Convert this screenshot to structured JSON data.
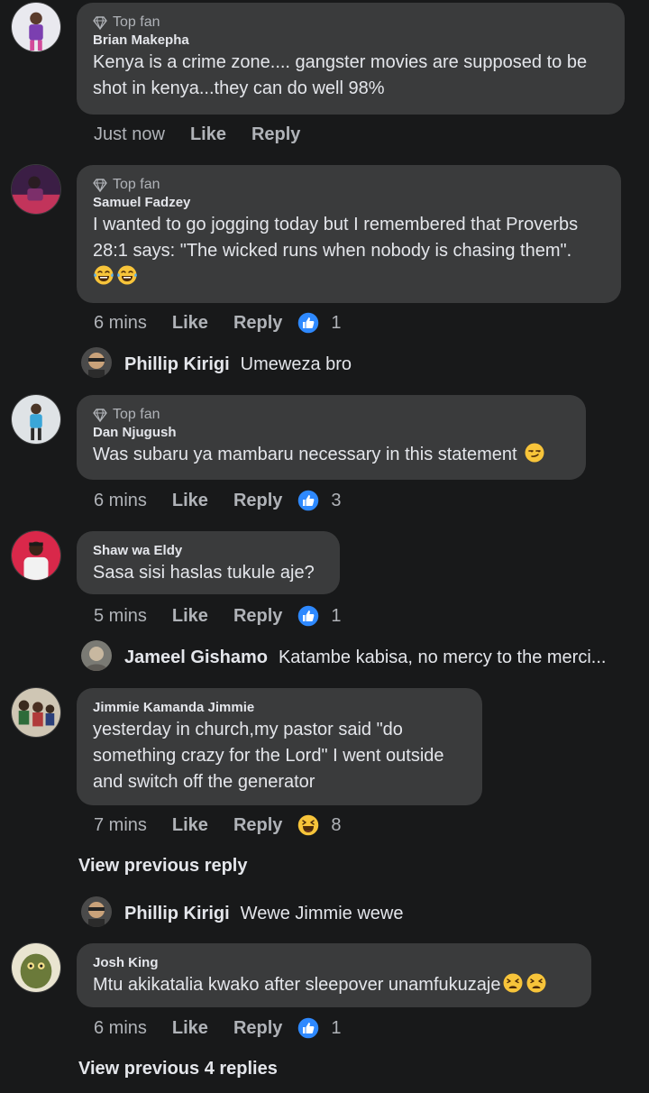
{
  "comments": [
    {
      "badge": "Top fan",
      "author": "Brian Makepha",
      "text": "Kenya is a crime zone.... gangster movies are supposed to be shot in kenya...they can do well 98%",
      "time": "Just now",
      "like": "Like",
      "reply": "Reply"
    },
    {
      "badge": "Top fan",
      "author": "Samuel Fadzey",
      "text": "I wanted to go jogging today but I remembered that Proverbs 28:1 says: \"The wicked runs when nobody is chasing them\".",
      "emojis": [
        "laughing-tears-emoji",
        "laughing-tears-emoji"
      ],
      "time": "6 mins",
      "like": "Like",
      "reply": "Reply",
      "reaction": "like-icon",
      "reaction_count": "1",
      "mini_reply": {
        "name": "Phillip Kirigi",
        "text": "Umeweza bro"
      }
    },
    {
      "badge": "Top fan",
      "author": "Dan Njugush",
      "text": "Was subaru ya mambaru necessary in this statement",
      "emojis": [
        "smirk-emoji"
      ],
      "time": "6 mins",
      "like": "Like",
      "reply": "Reply",
      "reaction": "like-icon",
      "reaction_count": "3"
    },
    {
      "author": "Shaw wa Eldy",
      "text": "Sasa sisi haslas tukule aje?",
      "time": "5 mins",
      "like": "Like",
      "reply": "Reply",
      "reaction": "like-icon",
      "reaction_count": "1",
      "mini_reply": {
        "name": "Jameel Gishamo",
        "text": "Katambe kabisa, no mercy to the merci..."
      }
    },
    {
      "author": "Jimmie Kamanda Jimmie",
      "text": "yesterday in church,my pastor said \"do something crazy for the Lord\" I went outside and switch off the generator",
      "time": "7 mins",
      "like": "Like",
      "reply": "Reply",
      "reaction": "haha-icon",
      "reaction_count": "8",
      "view_previous": "View previous reply",
      "mini_reply": {
        "name": "Phillip Kirigi",
        "text": "Wewe Jimmie wewe"
      }
    },
    {
      "author": "Josh King",
      "text": "Mtu akikatalia kwako after sleepover unamfukuzaje",
      "emojis": [
        "weary-emoji",
        "weary-emoji"
      ],
      "time": "6 mins",
      "like": "Like",
      "reply": "Reply",
      "reaction": "like-icon",
      "reaction_count": "1",
      "view_previous": "View previous 4 replies"
    }
  ],
  "colors": {
    "background": "#18191a",
    "bubble": "#3a3b3c",
    "text": "#e4e6eb",
    "secondary": "#b0b3b8",
    "like_blue": "#2e89ff",
    "haha_yellow": "#f7c43a"
  }
}
